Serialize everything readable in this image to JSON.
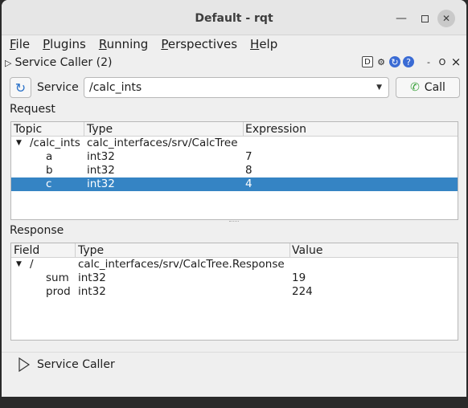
{
  "window": {
    "title": "Default - rqt"
  },
  "menubar": [
    {
      "label": "File",
      "mnemonic": "F",
      "rest": "ile"
    },
    {
      "label": "Plugins",
      "mnemonic": "P",
      "rest": "lugins"
    },
    {
      "label": "Running",
      "mnemonic": "R",
      "rest": "unning"
    },
    {
      "label": "Perspectives",
      "mnemonic": "P",
      "rest": "erspectives"
    },
    {
      "label": "Help",
      "mnemonic": "H",
      "rest": "elp"
    }
  ],
  "dock": {
    "title": "Service Caller (2)",
    "buttons": {
      "d": "D",
      "minimize": "-",
      "float": "O",
      "close": "×"
    }
  },
  "service": {
    "label": "Service",
    "selected": "/calc_ints",
    "call_label": "Call"
  },
  "request": {
    "label": "Request",
    "headers": [
      "Topic",
      "Type",
      "Expression"
    ],
    "root": {
      "topic": "/calc_ints",
      "type": "calc_interfaces/srv/CalcTree",
      "expression": ""
    },
    "rows": [
      {
        "topic": "a",
        "type": "int32",
        "expression": "7"
      },
      {
        "topic": "b",
        "type": "int32",
        "expression": "8"
      },
      {
        "topic": "c",
        "type": "int32",
        "expression": "4"
      }
    ]
  },
  "response": {
    "label": "Response",
    "headers": [
      "Field",
      "Type",
      "Value"
    ],
    "root": {
      "field": "/",
      "type": "calc_interfaces/srv/CalcTree.Response",
      "value": ""
    },
    "rows": [
      {
        "field": "sum",
        "type": "int32",
        "value": "19"
      },
      {
        "field": "prod",
        "type": "int32",
        "value": "224"
      }
    ]
  },
  "bottom": {
    "label": "Service Caller"
  }
}
